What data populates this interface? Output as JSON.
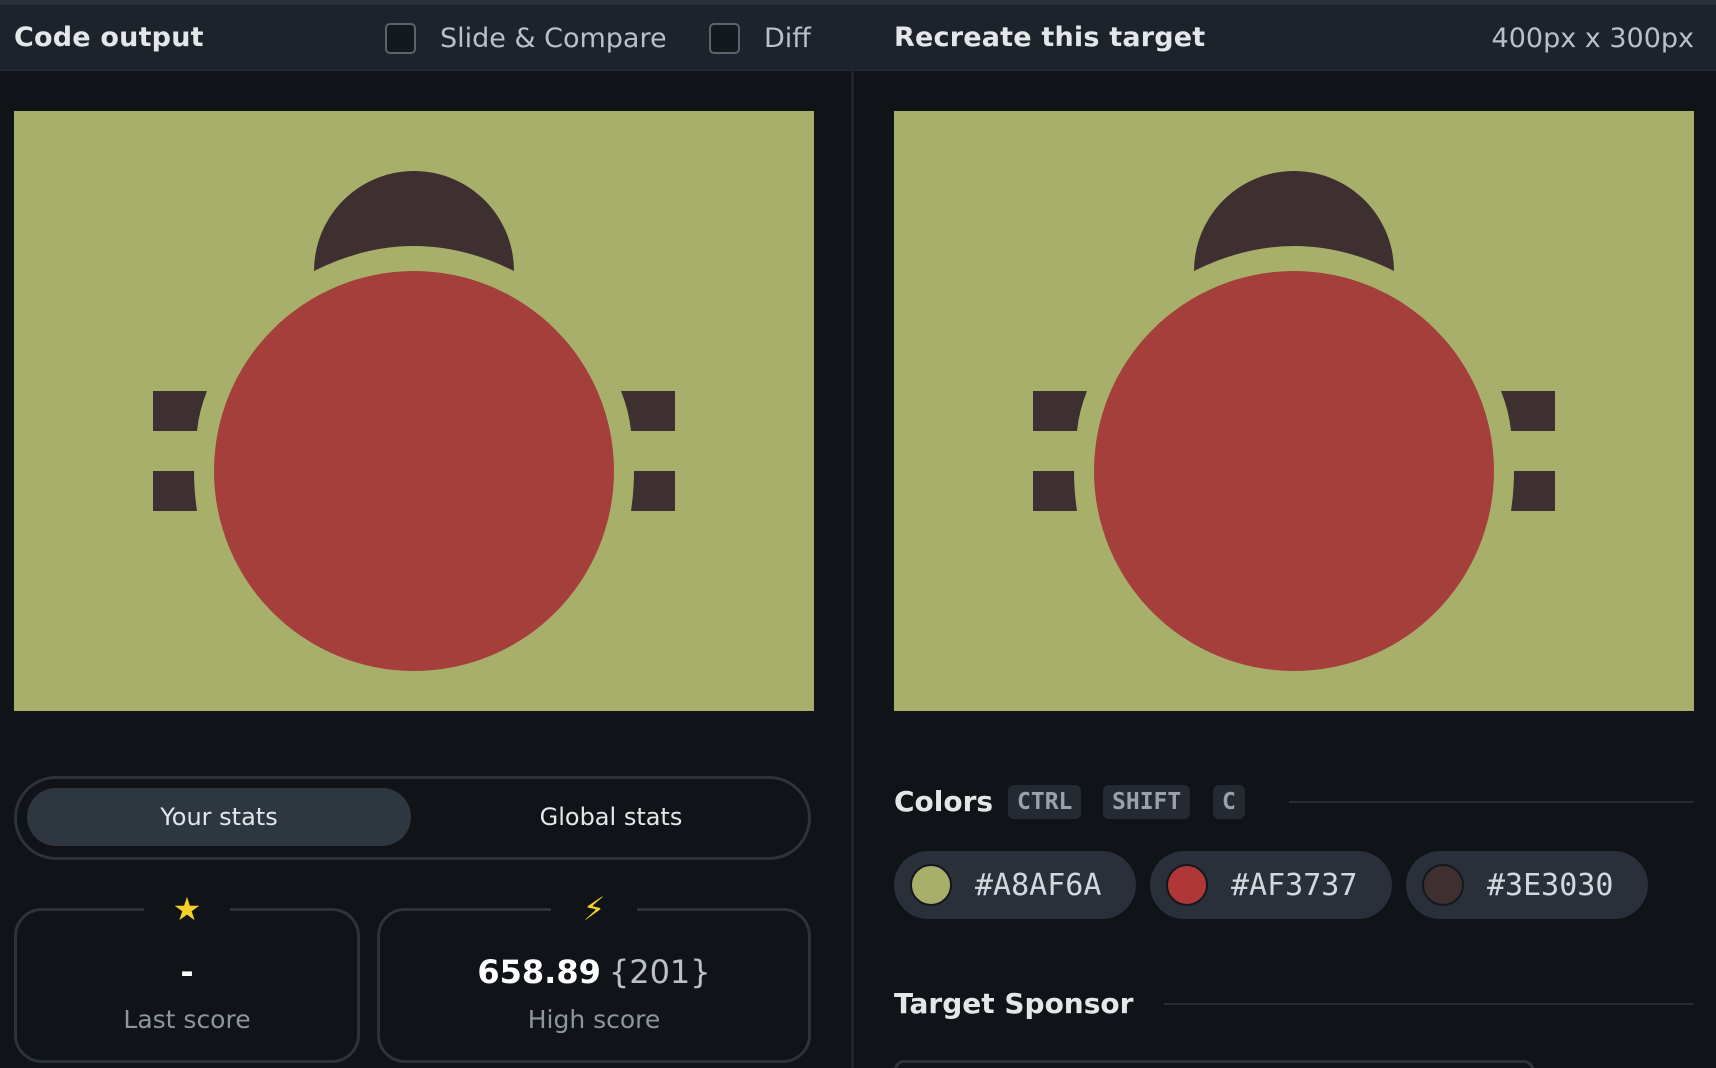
{
  "left": {
    "header": {
      "title": "Code output",
      "slide_compare_label": "Slide & Compare",
      "diff_label": "Diff"
    },
    "stats": {
      "tab_your": "Your stats",
      "tab_global": "Global stats",
      "last_score": {
        "value": "-",
        "label": "Last score"
      },
      "high_score": {
        "value": "658.89",
        "sub": "{201}",
        "label": "High score"
      }
    }
  },
  "right": {
    "header": {
      "title": "Recreate this target",
      "dimensions": "400px x 300px"
    },
    "colors": {
      "title": "Colors",
      "shortcut": [
        "CTRL",
        "SHIFT",
        "C"
      ],
      "swatches": [
        {
          "hex": "#A8AF6A"
        },
        {
          "hex": "#AF3737"
        },
        {
          "hex": "#3E3030"
        }
      ]
    },
    "sponsor": {
      "title": "Target Sponsor"
    }
  },
  "target": {
    "background": "#a8af6a",
    "body_color": "#a43f3c",
    "dark_color": "#3e3030"
  }
}
